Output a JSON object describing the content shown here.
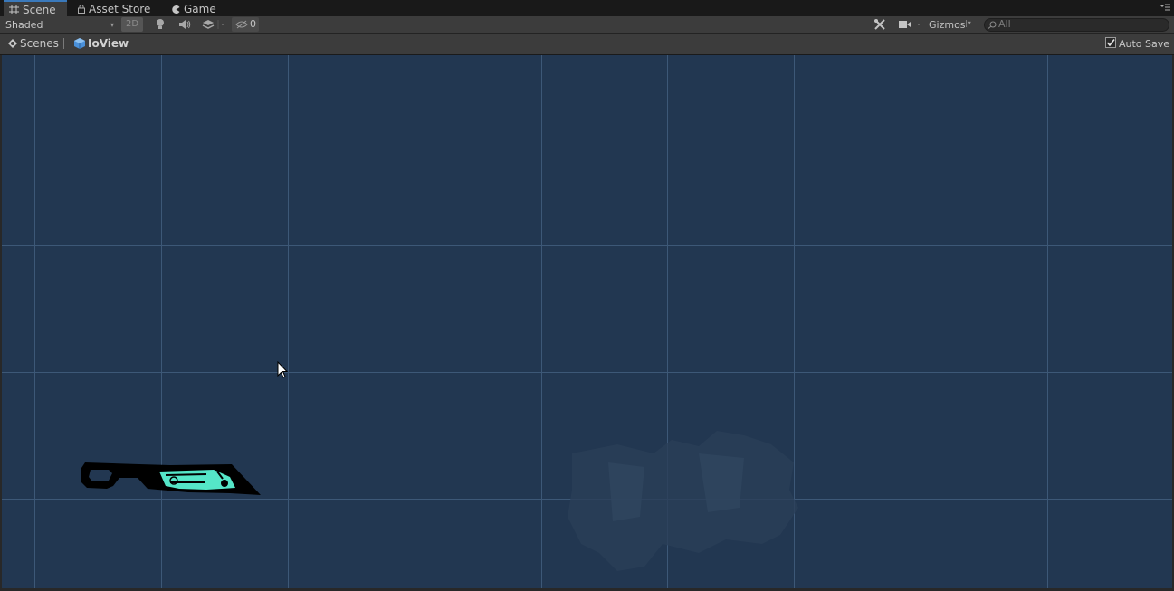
{
  "tabs": {
    "scene": "Scene",
    "asset_store": "Asset Store",
    "game": "Game"
  },
  "toolbar": {
    "shading_mode": "Shaded",
    "mode_2d": "2D",
    "hidden_count": "0",
    "gizmos": "Gizmos",
    "search_placeholder": "All"
  },
  "breadcrumb": {
    "root": "Scenes",
    "current": "IoView",
    "auto_save": "Auto Save"
  },
  "colors": {
    "accent": "#3a79bb",
    "viewport_bg": "#223751",
    "grid_line": "#3d5877",
    "knife_glow": "#55e6c8"
  }
}
